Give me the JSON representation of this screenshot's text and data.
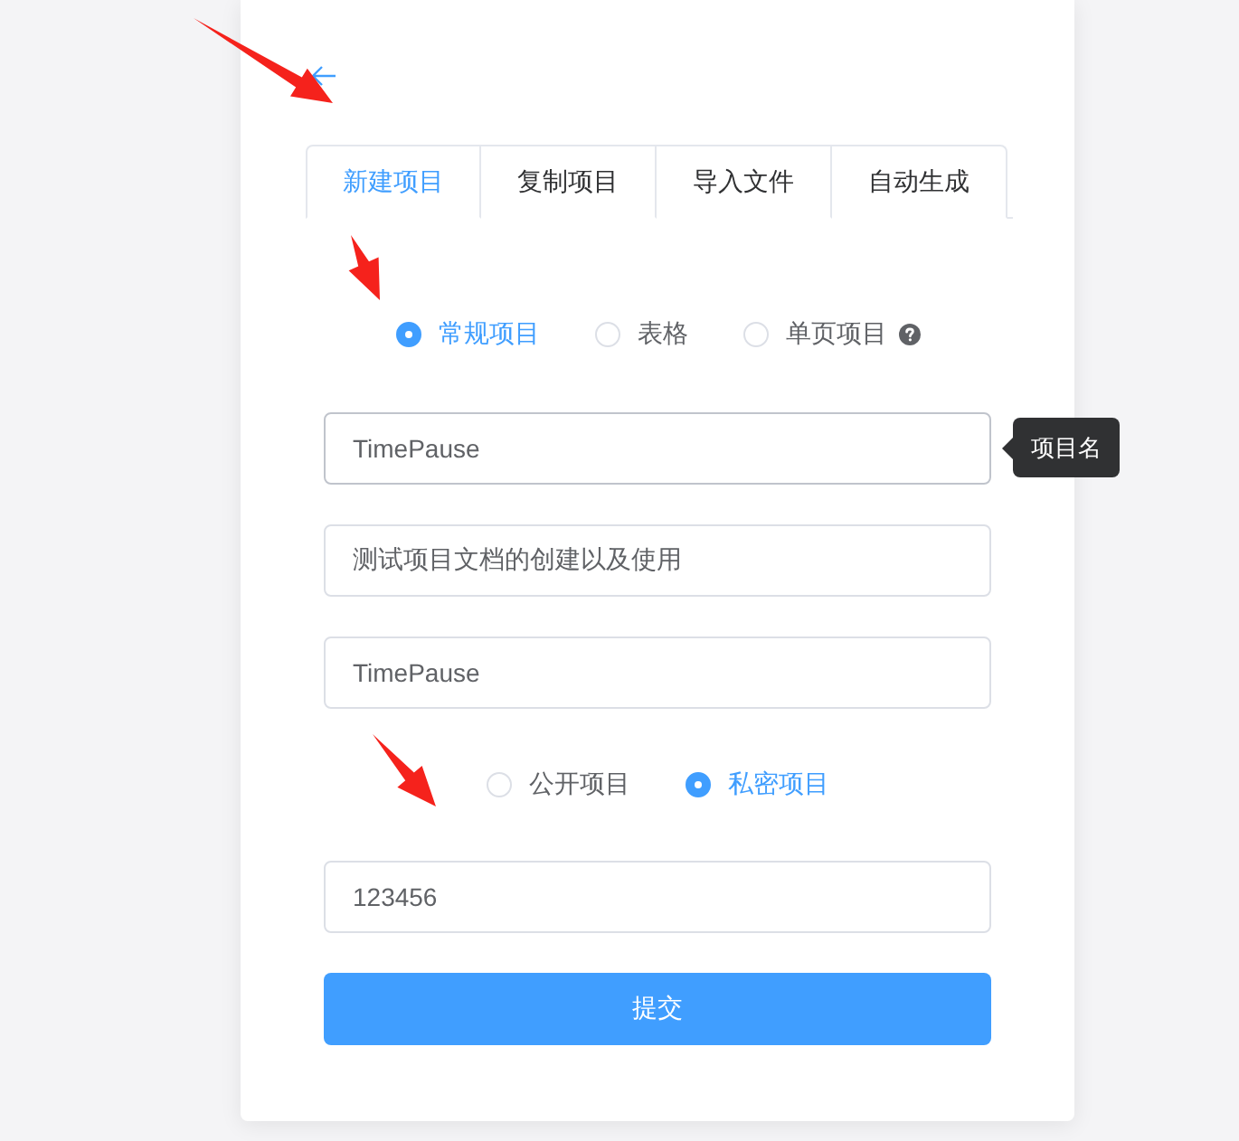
{
  "tabs": [
    {
      "label": "新建项目",
      "selected": true
    },
    {
      "label": "复制项目",
      "selected": false
    },
    {
      "label": "导入文件",
      "selected": false
    },
    {
      "label": "自动生成",
      "selected": false
    }
  ],
  "project_types": [
    {
      "label": "常规项目",
      "selected": true,
      "help": false
    },
    {
      "label": "表格",
      "selected": false,
      "help": false
    },
    {
      "label": "单页项目",
      "selected": false,
      "help": true
    }
  ],
  "fields": [
    {
      "value": "TimePause",
      "hovered": true,
      "tooltip": "项目名"
    },
    {
      "value": "测试项目文档的创建以及使用",
      "hovered": false
    },
    {
      "value": "TimePause",
      "hovered": false
    }
  ],
  "visibility": [
    {
      "label": "公开项目",
      "selected": false
    },
    {
      "label": "私密项目",
      "selected": true
    }
  ],
  "password_field": {
    "value": "123456",
    "hovered": false
  },
  "submit_button": {
    "label": "提交"
  }
}
